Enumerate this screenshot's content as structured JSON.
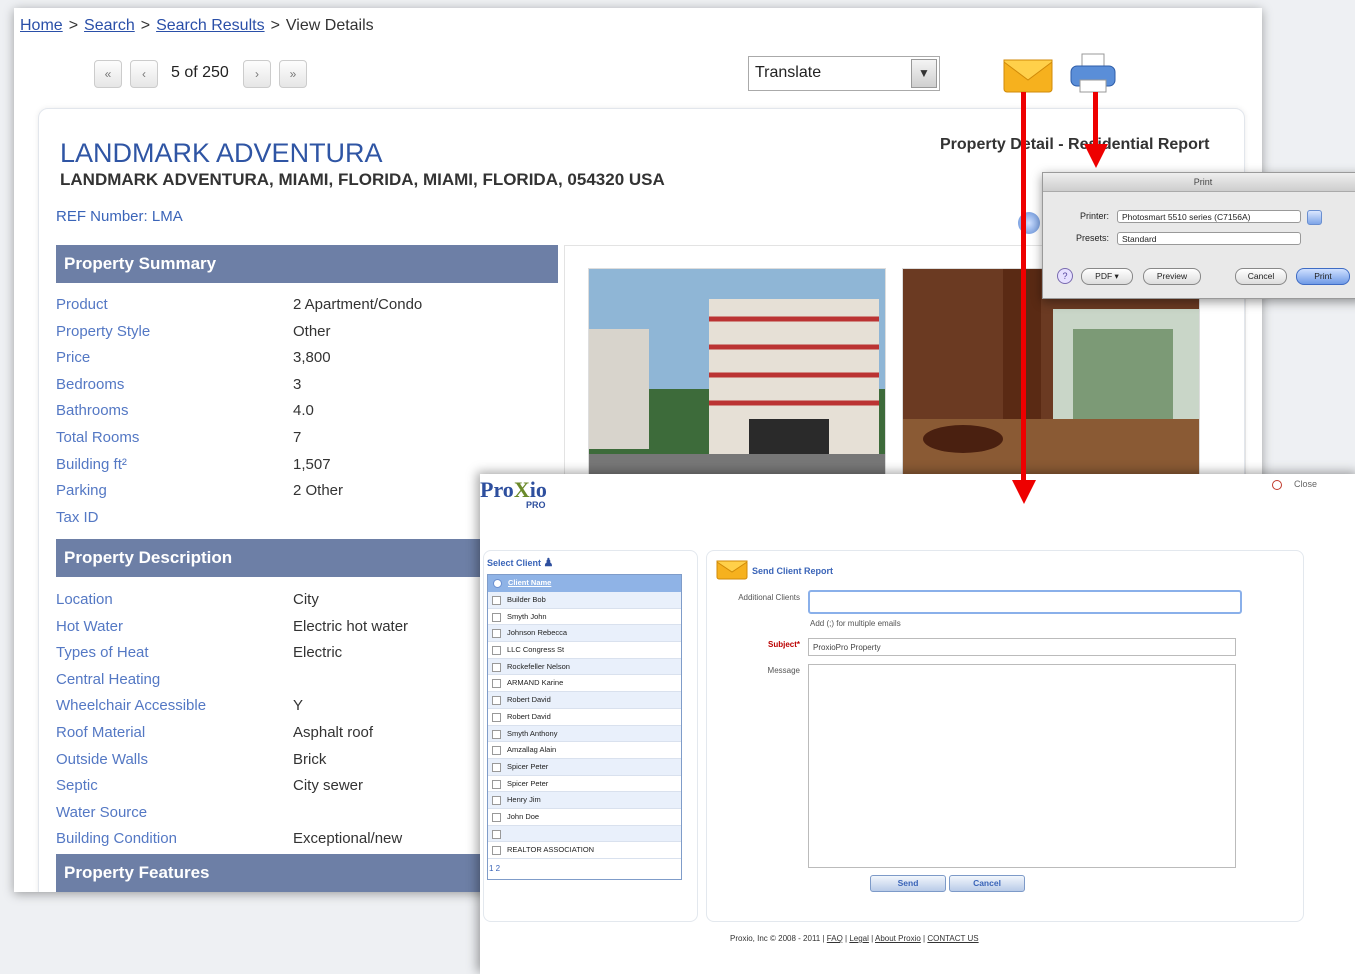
{
  "breadcrumb": {
    "home": "Home",
    "search": "Search",
    "results": "Search Results",
    "current": "View Details",
    "sep": ">"
  },
  "pager": {
    "first": "«",
    "prev": "‹",
    "count": "5 of 250",
    "next": "›",
    "last": "»"
  },
  "translate": {
    "label": "Translate"
  },
  "icons": {
    "mail": "mail-envelope-icon",
    "print": "printer-icon"
  },
  "property": {
    "title": "LANDMARK ADVENTURA",
    "address": "LANDMARK ADVENTURA, MIAMI, FLORIDA, MIAMI, FLORIDA, 054320 USA",
    "ref": "REF Number: LMA",
    "report": "Property Detail - Residential Report"
  },
  "summary": {
    "heading": "Property Summary",
    "rows": [
      {
        "k": "Product",
        "v": "2 Apartment/Condo"
      },
      {
        "k": "Property Style",
        "v": "Other"
      },
      {
        "k": "Price",
        "v": "3,800"
      },
      {
        "k": "Bedrooms",
        "v": "3"
      },
      {
        "k": "Bathrooms",
        "v": "4.0"
      },
      {
        "k": "Total Rooms",
        "v": "7"
      },
      {
        "k": "Building ft²",
        "v": "1,507"
      },
      {
        "k": "Parking",
        "v": "2 Other"
      },
      {
        "k": "Tax ID",
        "v": ""
      }
    ]
  },
  "description": {
    "heading": "Property Description",
    "rows": [
      {
        "k": "Location",
        "v": "City"
      },
      {
        "k": "Hot Water",
        "v": "Electric hot water"
      },
      {
        "k": "Types of Heat",
        "v": "Electric"
      },
      {
        "k": "Central Heating",
        "v": ""
      },
      {
        "k": "Wheelchair Accessible",
        "v": "Y"
      },
      {
        "k": "Roof Material",
        "v": "Asphalt roof"
      },
      {
        "k": "Outside Walls",
        "v": "Brick"
      },
      {
        "k": "Septic",
        "v": "City sewer"
      },
      {
        "k": "Water Source",
        "v": ""
      },
      {
        "k": "Building Condition",
        "v": "Exceptional/new"
      }
    ]
  },
  "features": {
    "heading": "Property Features"
  },
  "print_dialog": {
    "title": "Print",
    "printer_label": "Printer:",
    "printer_value": "Photosmart 5510 series (C7156A)",
    "presets_label": "Presets:",
    "presets_value": "Standard",
    "help": "?",
    "pdf": "PDF ▾",
    "preview": "Preview",
    "cancel": "Cancel",
    "print": "Print"
  },
  "proxio": {
    "logo": "Pro",
    "logo_x": "X",
    "logo_end": "io",
    "logo_sub": "PRO",
    "close": "Close",
    "select_client": "Select Client",
    "client_header": "Client Name",
    "clients": [
      "Builder Bob",
      "Smyth John",
      "Johnson Rebecca",
      "LLC Congress St",
      "Rockefeller Nelson",
      "ARMAND Karine",
      "Robert David",
      "Robert David",
      "Smyth Anthony",
      "Amzallag Alain",
      "Spicer Peter",
      "Spicer Peter",
      "Henry Jim",
      "John Doe",
      "",
      "REALTOR ASSOCIATION"
    ],
    "pages": "1 2",
    "send_report": "Send Client Report",
    "additional_label": "Additional Clients",
    "additional_hint": "Add (;) for multiple emails",
    "subject_label": "Subject*",
    "subject_value": "ProxioPro Property",
    "message_label": "Message",
    "send": "Send",
    "cancel": "Cancel",
    "footer_copy": "Proxio, Inc © 2008 - 2011",
    "footer_links": [
      "FAQ",
      "Legal",
      "About Proxio",
      "CONTACT US"
    ]
  }
}
